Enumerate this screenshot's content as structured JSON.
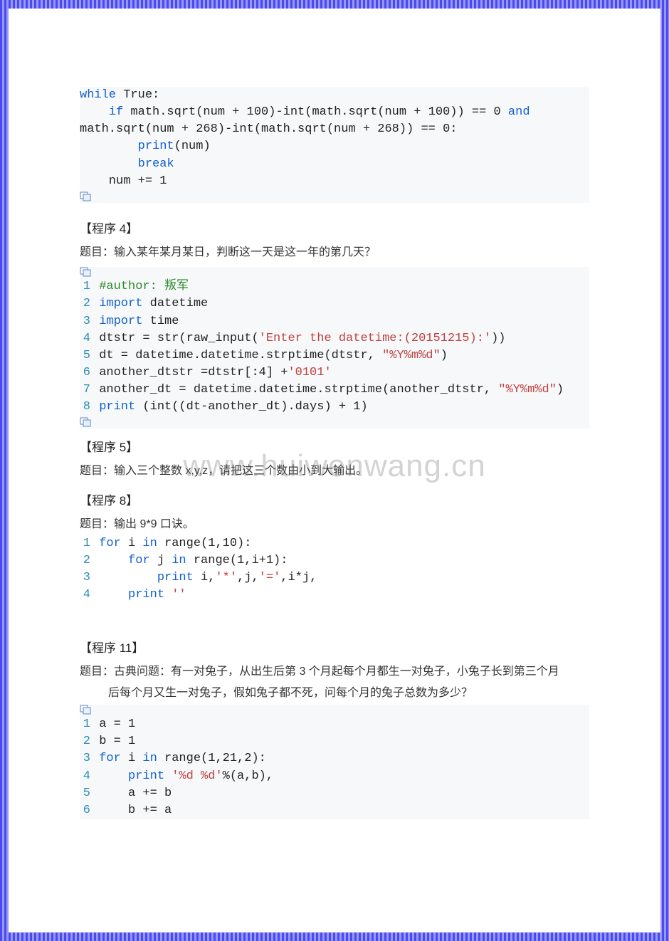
{
  "watermark": "www.huiwenwang.cn",
  "block1": {
    "l1a": "while",
    "l1b": " True:",
    "l2a": "    ",
    "l2b": "if",
    "l2c": " math.sqrt(num + 100)-int(math.sqrt(num + 100)) == 0 ",
    "l2d": "and",
    "l3": "math.sqrt(num + 268)-int(math.sqrt(num + 268)) == 0:",
    "l4a": "        ",
    "l4b": "print",
    "l4c": "(num)",
    "l5a": "        ",
    "l5b": "break",
    "l6": "    num += 1"
  },
  "sec4": {
    "head": "【程序 4】",
    "desc": "题目：输入某年某月某日，判断这一天是这一年的第几天？"
  },
  "block2": {
    "n1": "1",
    "l1": "#author: 叛军",
    "n2": "2",
    "l2a": "import",
    "l2b": " datetime",
    "n3": "3",
    "l3a": "import",
    "l3b": " time",
    "n4": "4",
    "l4a": "dtstr = str(raw_input(",
    "l4b": "'Enter the datetime:(20151215):'",
    "l4c": "))",
    "n5": "5",
    "l5a": "dt = datetime.datetime.strptime(dtstr, ",
    "l5b": "\"%Y%m%d\"",
    "l5c": ")",
    "n6": "6",
    "l6a": "another_dtstr =dtstr[:4] +",
    "l6b": "'0101'",
    "n7": "7",
    "l7a": "another_dt = datetime.datetime.strptime(another_dtstr, ",
    "l7b": "\"%Y%m%d\"",
    "l7c": ")",
    "n8": "8",
    "l8a": "print",
    "l8b": " (int((dt-another_dt).days) + 1)"
  },
  "sec5": {
    "head": "【程序 5】",
    "desc": "题目：输入三个整数 x,y,z，请把这三个数由小到大输出。"
  },
  "sec8": {
    "head": "【程序 8】",
    "desc": "题目：输出 9*9 口诀。"
  },
  "block3": {
    "n1": "1",
    "l1a": "for",
    "l1b": " i ",
    "l1c": "in",
    "l1d": " range(1,10):",
    "n2": "2",
    "l2a": "    ",
    "l2b": "for",
    "l2c": " j ",
    "l2d": "in",
    "l2e": " range(1,i+1):",
    "n3": "3",
    "l3a": "        ",
    "l3b": "print",
    "l3c": " i,",
    "l3d": "'*'",
    "l3e": ",j,",
    "l3f": "'='",
    "l3g": ",i*j,",
    "n4": "4",
    "l4a": "    ",
    "l4b": "print",
    "l4c": " ",
    "l4d": "''"
  },
  "sec11": {
    "head": "【程序 11】",
    "desc1": "题目：古典问题：有一对兔子，从出生后第 3 个月起每个月都生一对兔子，小兔子长到第三个月",
    "desc2": "后每个月又生一对兔子，假如兔子都不死，问每个月的兔子总数为多少？"
  },
  "block4": {
    "n1": "1",
    "l1": "a = 1",
    "n2": "2",
    "l2": "b = 1",
    "n3": "3",
    "l3a": "for",
    "l3b": " i ",
    "l3c": "in",
    "l3d": " range(1,21,2):",
    "n4": "4",
    "l4a": "    ",
    "l4b": "print",
    "l4c": " ",
    "l4d": "'%d %d'",
    "l4e": "%(a,b),",
    "n5": "5",
    "l5": "    a += b",
    "n6": "6",
    "l6": "    b += a"
  }
}
